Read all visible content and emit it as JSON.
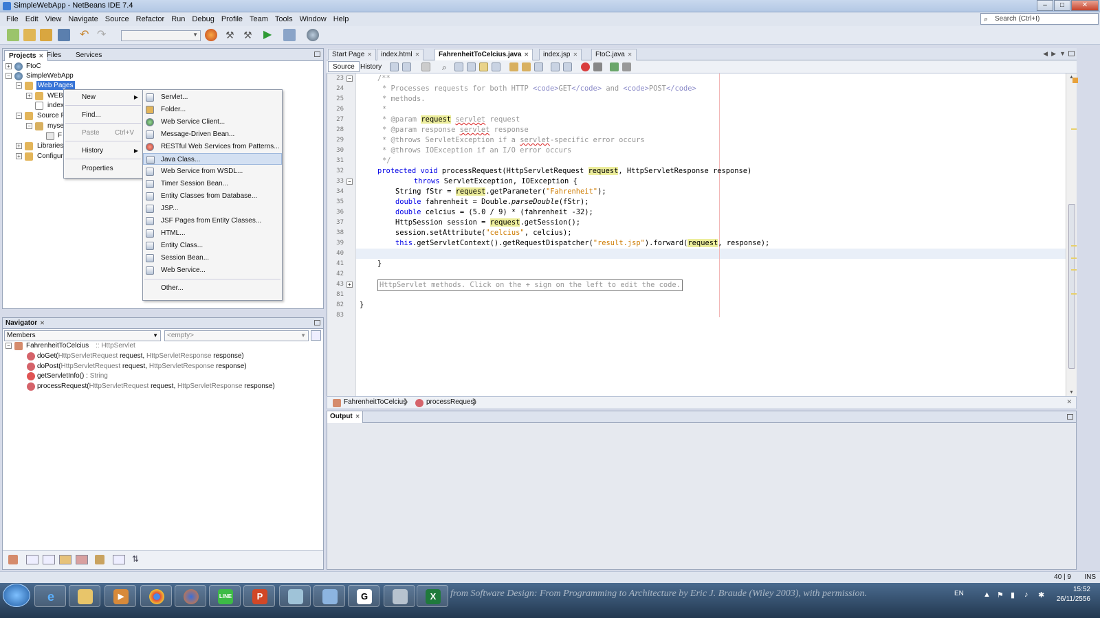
{
  "window": {
    "title": "SimpleWebApp - NetBeans IDE 7.4"
  },
  "menubar": {
    "items": [
      "File",
      "Edit",
      "View",
      "Navigate",
      "Source",
      "Refactor",
      "Run",
      "Debug",
      "Profile",
      "Team",
      "Tools",
      "Window",
      "Help"
    ]
  },
  "search": {
    "placeholder": "Search (Ctrl+I)"
  },
  "left_panel": {
    "tabs": [
      "Projects",
      "Files",
      "Services"
    ],
    "tree": [
      "FtoC",
      "SimpleWebApp",
      "Web Pages",
      "WEB",
      "index",
      "Source Pa",
      "myse",
      "F",
      "Libraries",
      "Configura"
    ]
  },
  "context_menu": {
    "items": [
      {
        "label": "New",
        "shortcut": ""
      },
      {
        "label": "Find...",
        "shortcut": ""
      },
      {
        "label": "Paste",
        "shortcut": "Ctrl+V"
      },
      {
        "label": "History",
        "shortcut": ""
      },
      {
        "label": "Properties",
        "shortcut": ""
      }
    ]
  },
  "submenu": {
    "items": [
      "Servlet...",
      "Folder...",
      "Web Service Client...",
      "Message-Driven Bean...",
      "RESTful Web Services from Patterns...",
      "Java Class...",
      "Web Service from WSDL...",
      "Timer Session Bean...",
      "Entity Classes from Database...",
      "JSP...",
      "JSF Pages from Entity Classes...",
      "HTML...",
      "Entity Class...",
      "Session Bean...",
      "Web Service...",
      "Other..."
    ],
    "highlighted": "Java Class..."
  },
  "navigator": {
    "title": "Navigator",
    "filter": "Members",
    "empty": "<empty>",
    "class_name": "FahrenheitToCelcius",
    "class_super": ":: HttpServlet",
    "members": [
      {
        "name": "doGet(",
        "params": "HttpServletRequest",
        "p1": " request, ",
        "ptype2": "HttpServletResponse",
        "p2": " response)"
      },
      {
        "name": "doPost(",
        "params": "HttpServletRequest",
        "p1": " request, ",
        "ptype2": "HttpServletResponse",
        "p2": " response)"
      },
      {
        "name": "getServletInfo() : ",
        "params": "String",
        "p1": "",
        "ptype2": "",
        "p2": ""
      },
      {
        "name": "processRequest(",
        "params": "HttpServletRequest",
        "p1": " request, ",
        "ptype2": "HttpServletResponse",
        "p2": " response)"
      }
    ]
  },
  "editor": {
    "tabs": [
      "Start Page",
      "index.html",
      "FahrenheitToCelcius.java",
      "index.jsp",
      "FtoC.java"
    ],
    "active_tab": "FahrenheitToCelcius.java",
    "modes": [
      "Source",
      "History"
    ],
    "line_numbers": [
      "23",
      "24",
      "25",
      "26",
      "27",
      "28",
      "29",
      "30",
      "31",
      "32",
      "33",
      "34",
      "35",
      "36",
      "37",
      "38",
      "39",
      "40",
      "41",
      "42",
      "43",
      "81",
      "82",
      "83"
    ],
    "code": {
      "l23": "/**",
      "l24a": "* Processes requests for both HTTP ",
      "l24b": "<code>",
      "l24c": "GET",
      "l24d": "</code>",
      "l24e": " and ",
      "l24f": "<code>",
      "l24g": "POST",
      "l24h": "</code>",
      "l25": "* methods.",
      "l26": "*",
      "l27a": "* @param ",
      "l27b": "request",
      "l27c": " ",
      "l27d": "servlet",
      "l27e": " request",
      "l28a": "* @param response ",
      "l28b": "servlet",
      "l28c": " response",
      "l29a": "* @throws ServletException if a ",
      "l29b": "servlet",
      "l29c": "-specific error occurs",
      "l30": "* @throws IOException if an I/O error occurs",
      "l31": "*/",
      "l32a": "protected void",
      "l32b": " processRequest(HttpServletRequest ",
      "l32c": "request",
      "l32d": ", HttpServletResponse response)",
      "l33a": "throws",
      "l33b": " ServletException, IOException {",
      "l34a": "String fStr = ",
      "l34b": "request",
      "l34c": ".getParameter(",
      "l34d": "\"Fahrenheit\"",
      "l34e": ");",
      "l35a": "double",
      "l35b": " fahrenheit = Double.",
      "l35c": "parseDouble",
      "l35d": "(fStr);",
      "l36a": "double",
      "l36b": " celcius = (5.0 / 9) * (fahrenheit -32);",
      "l37a": "HttpSession session = ",
      "l37b": "request",
      "l37c": ".getSession();",
      "l38a": "session.setAttribute(",
      "l38b": "\"celcius\"",
      "l38c": ", celcius);",
      "l39a": "this",
      "l39b": ".getServletContext().getRequestDispatcher(",
      "l39c": "\"result.jsp\"",
      "l39d": ").forward(",
      "l39e": "request",
      "l39f": ", response);",
      "l41": "}",
      "l43": "HttpServlet methods. Click on the + sign on the left to edit the code.",
      "l82": "}"
    },
    "breadcrumbs": [
      "FahrenheitToCelcius",
      "processRequest"
    ]
  },
  "output": {
    "title": "Output"
  },
  "status": {
    "position": "40 | 9",
    "mode": "INS"
  },
  "taskbar": {
    "banner": "from Software Design: From Programming to Architecture by Eric J. Braude (Wiley 2003), with permission.",
    "lang": "EN",
    "time": "15:52",
    "date": "26/11/2556"
  },
  "colors": {
    "keyword": "#0000e6",
    "string": "#ce7b00",
    "comment": "#969696",
    "highlight": "#eced9b"
  }
}
